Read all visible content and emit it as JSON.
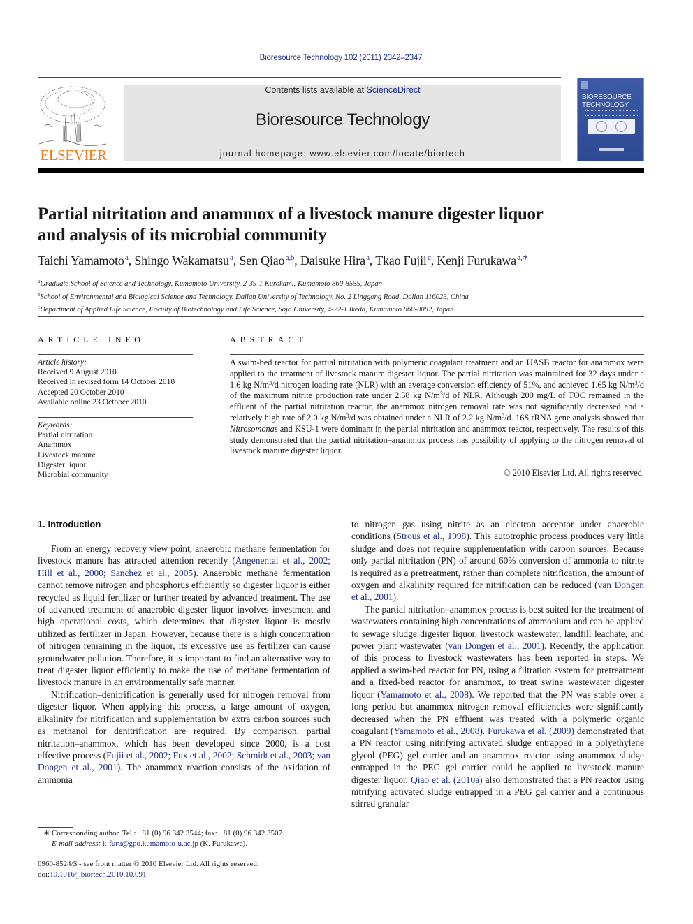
{
  "header": {
    "citation": "Bioresource Technology 102 (2011) 2342–2347",
    "contents_prefix": "Contents lists available at ",
    "contents_link": "ScienceDirect",
    "journal_name": "Bioresource Technology",
    "homepage": "journal homepage: www.elsevier.com/locate/biortech",
    "publisher_logo_text": "ELSEVIER",
    "cover_title_line1": "BIORESOURCE",
    "cover_title_line2": "TECHNOLOGY",
    "colors": {
      "link": "#1f2f8c",
      "elsevier_orange": "#f07d1a",
      "masthead_bg": "#e4e4e4",
      "cover_blue": "#3c5aa5"
    }
  },
  "article": {
    "title_line1": "Partial nitritation and anammox of a livestock manure digester liquor",
    "title_line2": "and analysis of its microbial community",
    "authors": [
      {
        "name": "Taichi Yamamoto",
        "aff": "a",
        "sep": ", "
      },
      {
        "name": "Shingo Wakamatsu",
        "aff": "a",
        "sep": ", "
      },
      {
        "name": "Sen Qiao",
        "aff": "a,b",
        "sep": ", "
      },
      {
        "name": "Daisuke Hira",
        "aff": "a",
        "sep": ", "
      },
      {
        "name": "Tkao Fujii",
        "aff": "c",
        "sep": ", "
      },
      {
        "name": "Kenji Furukawa",
        "aff": "a,∗",
        "sep": ""
      }
    ],
    "affiliations": [
      {
        "key": "a",
        "text": "Graduate School of Science and Technology, Kumamoto University, 2-39-1 Kurokami, Kumamoto 860-8555, Japan"
      },
      {
        "key": "b",
        "text": "School of Environmental and Biological Science and Technology, Dalian University of Technology, No. 2 Linggong Road, Dalian 116023, China"
      },
      {
        "key": "c",
        "text": "Department of Applied Life Science, Faculty of Biotechnology and Life Science, Sojo University, 4-22-1 Ikeda, Kumamoto 860-0082, Japan"
      }
    ]
  },
  "article_info": {
    "label": "ARTICLE INFO",
    "history_heading": "Article history:",
    "history": [
      "Received 9 August 2010",
      "Received in revised form 14 October 2010",
      "Accepted 20 October 2010",
      "Available online 23 October 2010"
    ],
    "keywords_heading": "Keywords:",
    "keywords": [
      "Partial nitritation",
      "Anammox",
      "Livestock manure",
      "Digester liquor",
      "Microbial community"
    ]
  },
  "abstract": {
    "label": "ABSTRACT",
    "s1": "A swim-bed reactor for partial nitritation with polymeric coagulant treatment and an UASB reactor for anammox were applied to the treatment of livestock manure digester liquor. The partial nitritation was maintained for 32 days under a 1.6 kg N/m",
    "s2": "/d nitrogen loading rate (NLR) with an average conversion efficiency of 51%, and achieved 1.65 kg N/m",
    "s3": "/d of the maximum nitrite production rate under 2.58 kg N/m",
    "s4": "/d of NLR. Although 200 mg/L of TOC remained in the effluent of the partial nitritation reactor, the anammox nitrogen removal rate was not significantly decreased and a relatively high rate of 2.0 kg N/m",
    "s5": "/d was obtained under a NLR of 2.2 kg N/m",
    "s6": "/d. 16S rRNA gene analysis showed that ",
    "s7_italic": "Nitrosomonas",
    "s8": " and KSU-1 were dominant in the partial nitritation and anammox reactor, respectively. The results of this study demonstrated that the partial nitritation–anammox process has possibility of applying to the nitrogen removal of livestock manure digester liquor.",
    "sup3": "3",
    "copyright": "© 2010 Elsevier Ltd. All rights reserved."
  },
  "body": {
    "heading": "1. Introduction",
    "left": {
      "p1a": "From an energy recovery view point, anaerobic methane fermentation for livestock manure has attracted attention recently (",
      "p1_ref1": "Angenental et al., 2002; Hill et al., 2000; Sanchez et al., 2005",
      "p1b": "). Anaerobic methane fermentation cannot remove nitrogen and phosphorus efficiently so digester liquor is either recycled as liquid fertilizer or further treated by advanced treatment. The use of advanced treatment of anaerobic digester liquor involves investment and high operational costs, which determines that digester liquor is mostly utilized as fertilizer in Japan. However, because there is a high concentration of nitrogen remaining in the liquor, its excessive use as fertilizer can cause groundwater pollution. Therefore, it is important to find an alternative way to treat digester liquor efficiently to make the use of methane fermentation of livestock manure in an environmentally safe manner.",
      "p2a": "Nitrification–denitrification is generally used for nitrogen removal from digester liquor. When applying this process, a large amount of oxygen, alkalinity for nitrification and supplementation by extra carbon sources such as methanol for denitrification are required. By comparison, partial nitritation–anammox, which has been developed since 2000, is a cost effective process (",
      "p2_ref1": "Fujii et al., 2002; Fux et al., 2002; Schmidt et al., 2003; van Dongen et al., 2001",
      "p2b": "). The anammox reaction consists of the oxidation of ammonia"
    },
    "right": {
      "p1a": "to nitrogen gas using nitrite as an electron acceptor under anaerobic conditions (",
      "p1_ref1": "Strous et al., 1998",
      "p1b": "). This autotrophic process produces very little sludge and does not require supplementation with carbon sources. Because only partial nitritation (PN) of around 60% conversion of ammonia to nitrite is required as a pretreatment, rather than complete nitrification, the amount of oxygen and alkalinity required for nitrification can be reduced (",
      "p1_ref2": "van Dongen et al., 2001",
      "p1c": ").",
      "p2a": "The partial nitritation–anammox process is best suited for the treatment of wastewaters containing high concentrations of ammonium and can be applied to sewage sludge digester liquor, livestock wastewater, landfill leachate, and power plant wastewater (",
      "p2_ref1": "van Dongen et al., 2001",
      "p2b": "). Recently, the application of this process to livestock wastewaters has been reported in steps. We applied a swim-bed reactor for PN, using a filtration system for pretreatment and a fixed-bed reactor for anammox, to treat swine wastewater digester liquor (",
      "p2_ref2": "Yamamoto et al., 2008",
      "p2c": "). We reported that the PN was stable over a long period but anammox nitrogen removal efficiencies were significantly decreased when the PN effluent was treated with a polymeric organic coagulant (",
      "p2_ref3": "Yamamoto et al., 2008",
      "p2d": "). ",
      "p2_ref4": "Furukawa et al. (2009)",
      "p2e": " demonstrated that a PN reactor using nitrifying activated sludge entrapped in a polyethylene glycol (PEG) gel carrier and an anammox reactor using anammox sludge entrapped in the PEG gel carrier could be applied to livestock manure digester liquor. ",
      "p2_ref5": "Qiao et al. (2010a)",
      "p2f": " also demonstrated that a PN reactor using nitrifying activated sludge entrapped in a PEG gel carrier and a continuous stirred granular"
    }
  },
  "footnotes": {
    "star": "∗",
    "corresponding": " Corresponding author. Tel.: +81 (0) 96 342 3544; fax: +81 (0) 96 342 3507.",
    "email_label": "E-mail address: ",
    "email": "k-furu@gpo.kumamoto-u.ac.jp",
    "email_suffix": " (K. Furukawa).",
    "issn": "0960-8524/$ - see front matter © 2010 Elsevier Ltd. All rights reserved.",
    "doi_label": "doi:",
    "doi": "10.1016/j.biortech.2010.10.091"
  }
}
